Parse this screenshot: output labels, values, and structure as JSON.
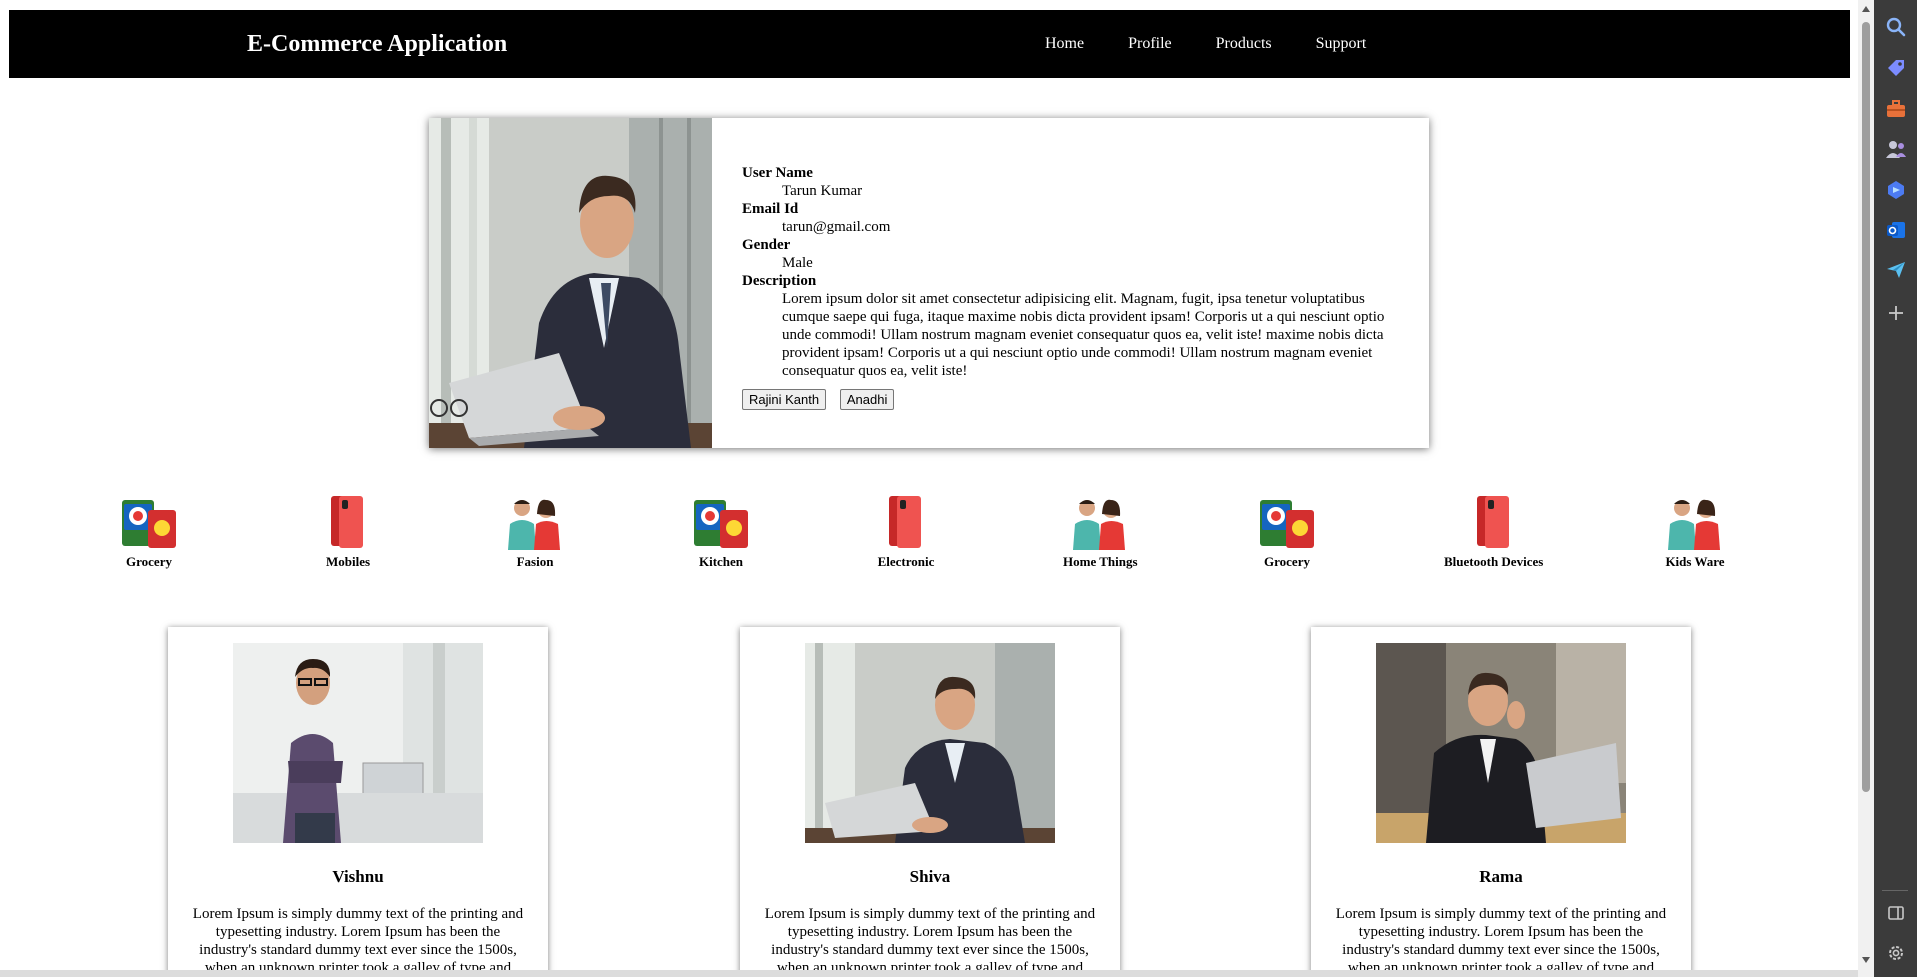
{
  "navbar": {
    "brand": "E-Commerce Application",
    "links": [
      "Home",
      "Profile",
      "Products",
      "Support"
    ]
  },
  "profile": {
    "fields": [
      {
        "label": "User Name",
        "value": "Tarun Kumar"
      },
      {
        "label": "Email Id",
        "value": "tarun@gmail.com"
      },
      {
        "label": "Gender",
        "value": "Male"
      },
      {
        "label": "Description",
        "value": "Lorem ipsum dolor sit amet consectetur adipisicing elit. Magnam, fugit, ipsa tenetur voluptatibus cumque saepe qui fuga, itaque maxime nobis dicta provident ipsam! Corporis ut a qui nesciunt optio unde commodi! Ullam nostrum magnam eveniet consequatur quos ea, velit iste! maxime nobis dicta provident ipsam! Corporis ut a qui nesciunt optio unde commodi! Ullam nostrum magnam eveniet consequatur quos ea, velit iste!"
      }
    ],
    "buttons": [
      "Rajini Kanth",
      "Anadhi"
    ]
  },
  "categories": [
    {
      "label": "Grocery",
      "icon": "detergent-pack-icon"
    },
    {
      "label": "Mobiles",
      "icon": "red-phone-icon"
    },
    {
      "label": "Fasion",
      "icon": "couple-icon"
    },
    {
      "label": "Kitchen",
      "icon": "detergent-pack-icon"
    },
    {
      "label": "Electronic",
      "icon": "red-phone-icon"
    },
    {
      "label": "Home Things",
      "icon": "couple-icon"
    },
    {
      "label": "Grocery",
      "icon": "detergent-pack-icon"
    },
    {
      "label": "Bluetooth Devices",
      "icon": "red-phone-icon"
    },
    {
      "label": "Kids Ware",
      "icon": "couple-icon"
    }
  ],
  "people": [
    {
      "name": "Vishnu",
      "text": "Lorem Ipsum is simply dummy text of the printing and typesetting industry. Lorem Ipsum has been the industry's standard dummy text ever since the 1500s, when an unknown printer took a galley of type and"
    },
    {
      "name": "Shiva",
      "text": "Lorem Ipsum is simply dummy text of the printing and typesetting industry. Lorem Ipsum has been the industry's standard dummy text ever since the 1500s, when an unknown printer took a galley of type and"
    },
    {
      "name": "Rama",
      "text": "Lorem Ipsum is simply dummy text of the printing and typesetting industry. Lorem Ipsum has been the industry's standard dummy text ever since the 1500s, when an unknown printer took a galley of type and"
    }
  ],
  "sidebar_icons": [
    "search-icon",
    "tag-icon",
    "briefcase-icon",
    "people-icon",
    "copilot-icon",
    "outlook-icon",
    "send-icon",
    "add-icon",
    "panel-icon",
    "settings-icon"
  ]
}
